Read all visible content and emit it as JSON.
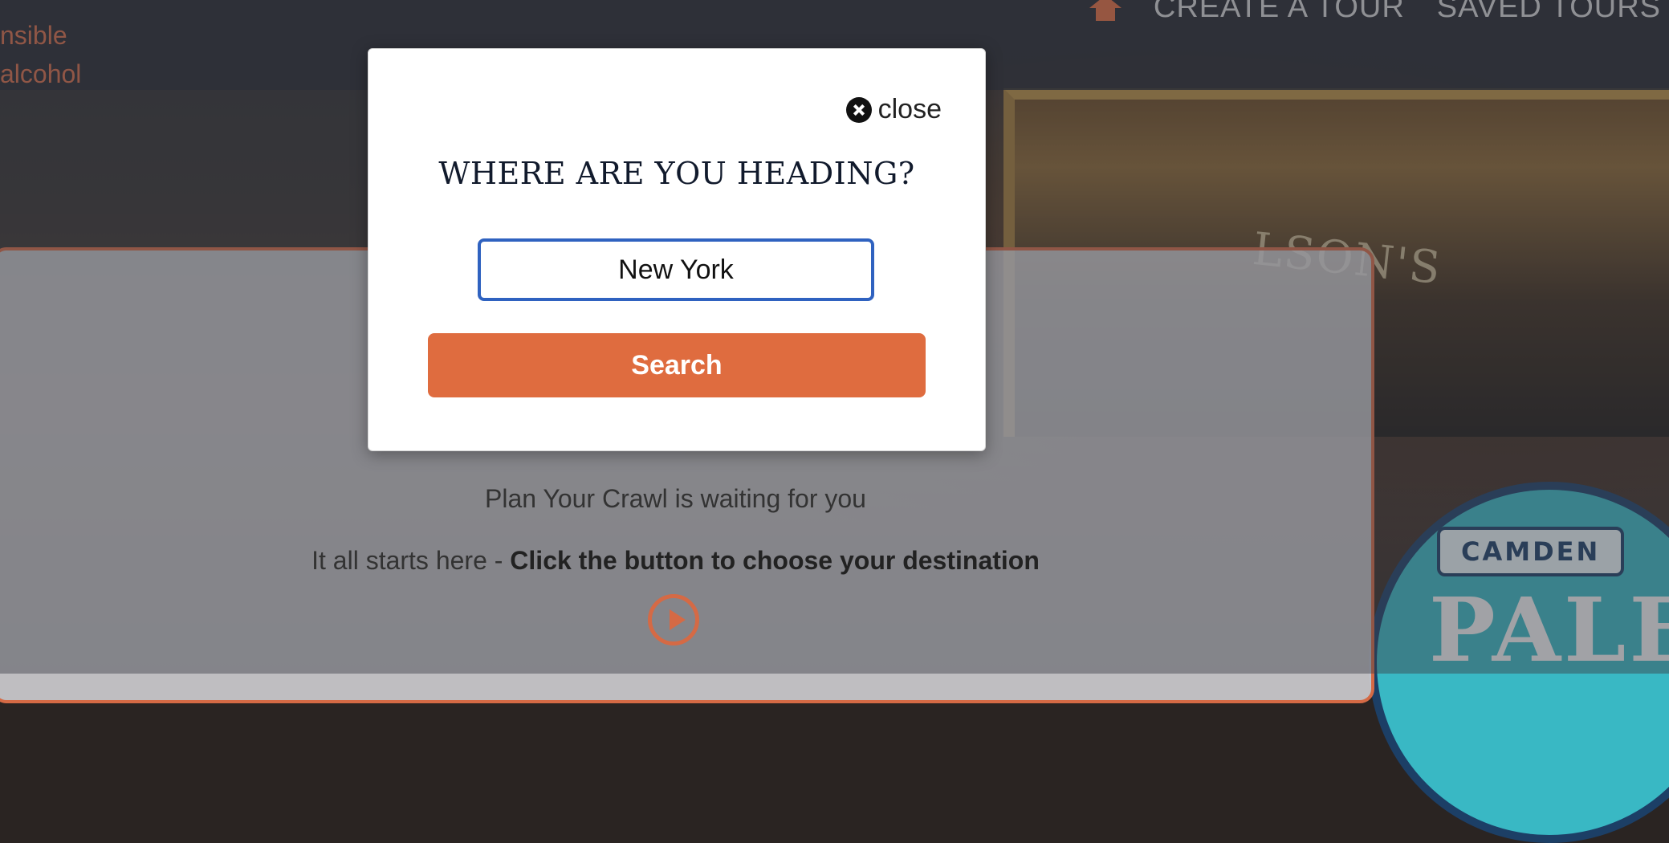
{
  "nav": {
    "items": [
      "CREATE A TOUR",
      "SAVED TOURS"
    ]
  },
  "left_notice": {
    "line1": "nsible",
    "line2": "alcohol"
  },
  "background": {
    "mirror_text": "LSON'S",
    "badge_brand": "CAMDEN",
    "badge_product": "PALE"
  },
  "panel": {
    "line1": "Plan Your Crawl is waiting for you",
    "line2_prefix": "It all starts here - ",
    "line2_bold": "Click the button to choose your destination"
  },
  "modal": {
    "close_label": "close",
    "title": "WHERE ARE YOU HEADING?",
    "input_value": "New York",
    "search_label": "Search"
  },
  "colors": {
    "accent": "#df6c3f",
    "input_border": "#2f62c0"
  }
}
